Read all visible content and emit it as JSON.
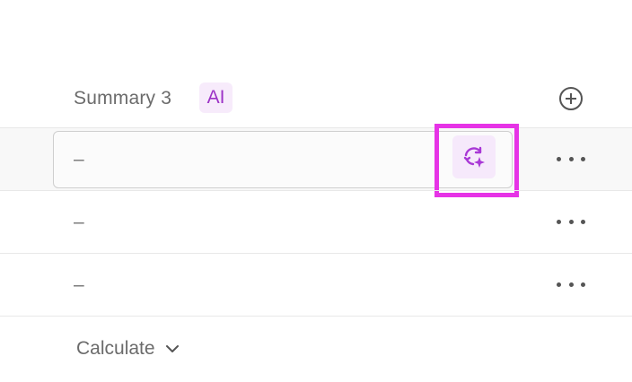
{
  "header": {
    "column_title": "Summary 3",
    "ai_badge": "AI",
    "add_column_icon": "plus-circle-icon"
  },
  "rows": [
    {
      "value": "–",
      "editing": true
    },
    {
      "value": "–",
      "editing": false
    },
    {
      "value": "–",
      "editing": false
    }
  ],
  "regenerate_icon": "ai-regenerate-icon",
  "row_menu_icon": "more-horizontal-icon",
  "footer": {
    "calculate_label": "Calculate",
    "calculate_icon": "chevron-down-icon"
  },
  "colors": {
    "accent_purple": "#9c32c6",
    "highlight_magenta": "#e633e6",
    "badge_bg": "#f7ebfb"
  }
}
